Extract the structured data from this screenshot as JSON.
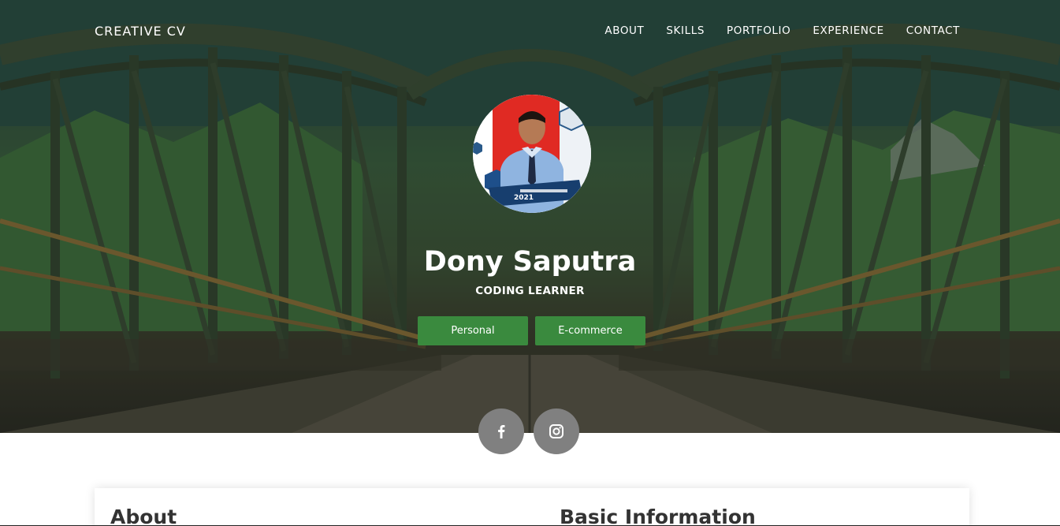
{
  "nav": {
    "brand": "CREATIVE CV",
    "items": [
      "ABOUT",
      "SKILLS",
      "PORTFOLIO",
      "EXPERIENCE",
      "CONTACT"
    ]
  },
  "hero": {
    "name": "Dony Saputra",
    "subtitle": "CODING LEARNER",
    "avatar_caption": "2021",
    "buttons": {
      "personal": "Personal",
      "ecommerce": "E-commerce"
    },
    "social": {
      "facebook": "facebook-icon",
      "instagram": "instagram-icon"
    }
  },
  "sections": {
    "about_title": "About",
    "basic_info_title": "Basic Information"
  },
  "colors": {
    "button_green": "#3a8a3e",
    "social_gray": "#808080",
    "hero_overlay": "#27443a"
  }
}
